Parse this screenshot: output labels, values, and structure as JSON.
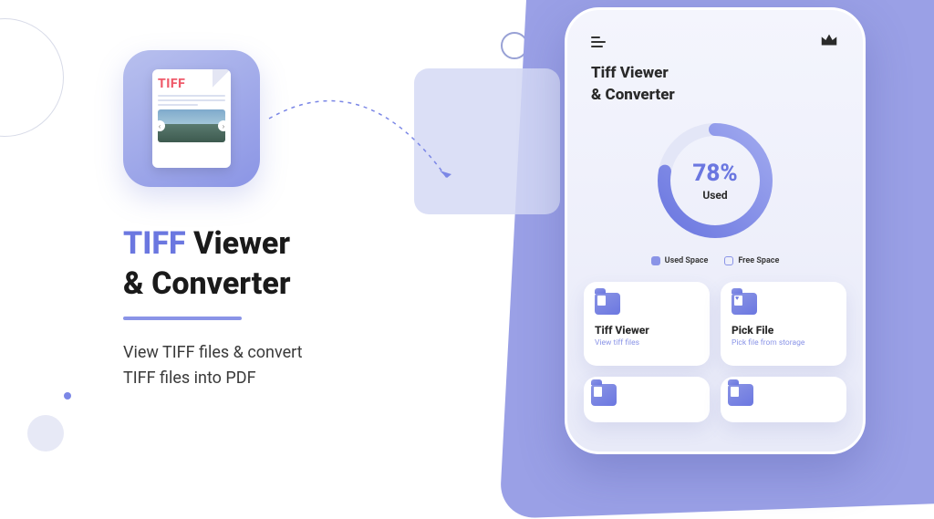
{
  "colors": {
    "accent": "#6b77e0",
    "accent_light": "#8a94e7",
    "tiff_red": "#ef5b6b"
  },
  "hero": {
    "icon_label": "TIFF",
    "title_accent": "TIFF",
    "title_rest_line1": " Viewer",
    "title_line2": "& Converter",
    "subtitle_line1": "View TIFF files & convert",
    "subtitle_line2": "TIFF files into PDF"
  },
  "phone": {
    "app_title_line1": "Tiff Viewer",
    "app_title_line2": "& Converter",
    "chart_data": {
      "type": "pie",
      "title": "",
      "values": [
        78,
        22
      ],
      "categories": [
        "Used Space",
        "Free Space"
      ],
      "center_value": "78%",
      "center_label": "Used"
    },
    "legend": {
      "used": "Used Space",
      "free": "Free Space"
    },
    "cards": [
      {
        "title": "Tiff Viewer",
        "subtitle": "View tiff files",
        "icon": "folder-doc"
      },
      {
        "title": "Pick File",
        "subtitle": "Pick file from storage",
        "icon": "folder-heart"
      }
    ]
  }
}
